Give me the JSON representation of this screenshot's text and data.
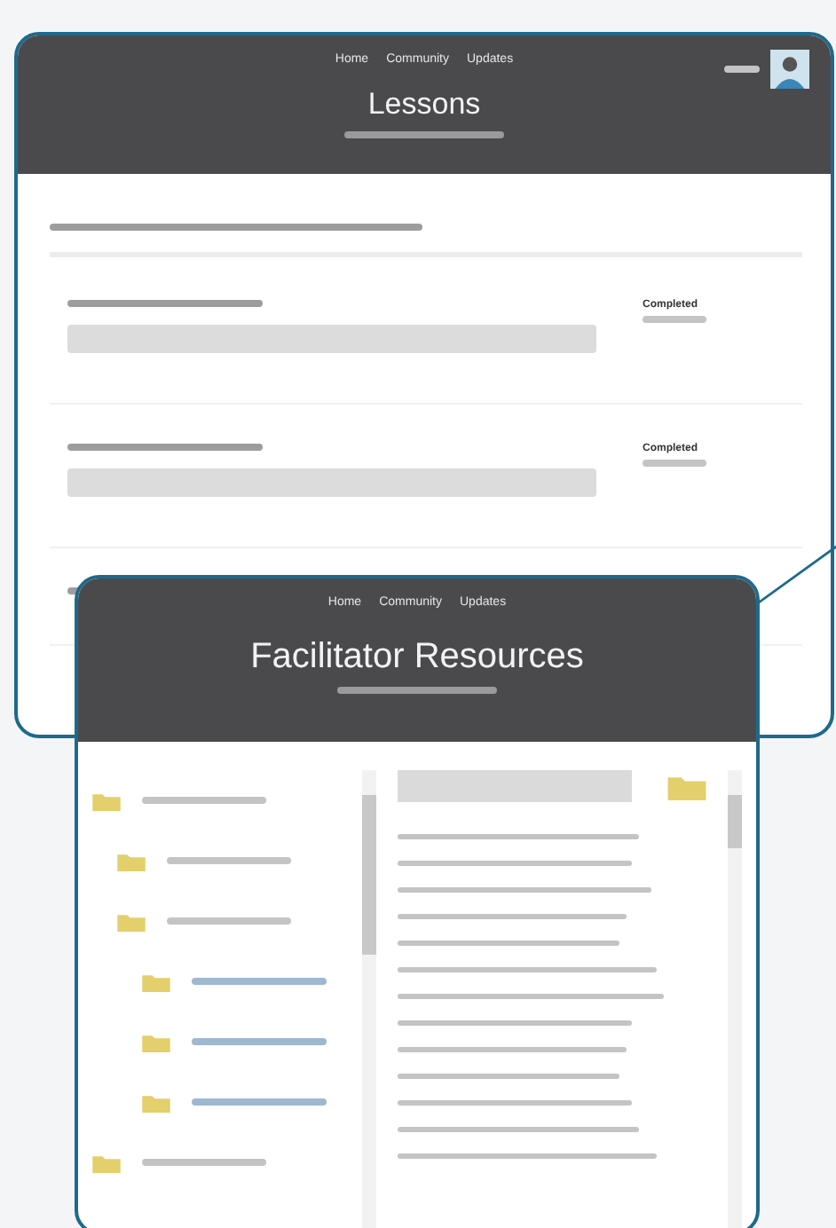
{
  "back_window": {
    "nav": [
      "Home",
      "Community",
      "Updates"
    ],
    "title": "Lessons",
    "lessons": [
      {
        "kind": "full",
        "status": "Completed"
      },
      {
        "kind": "full",
        "status": "Completed"
      },
      {
        "kind": "partial"
      }
    ]
  },
  "front_window": {
    "nav": [
      "Home",
      "Community",
      "Updates"
    ],
    "title": "Facilitator Resources",
    "tree": [
      {
        "kind": "folder",
        "children": [
          {
            "kind": "folder"
          },
          {
            "kind": "folder",
            "children": [
              {
                "kind": "link"
              },
              {
                "kind": "link"
              },
              {
                "kind": "link"
              }
            ]
          }
        ]
      },
      {
        "kind": "folder"
      }
    ],
    "files": [
      {
        "kind": "file"
      },
      {
        "kind": "file"
      },
      {
        "kind": "file"
      },
      {
        "kind": "file"
      },
      {
        "kind": "file"
      },
      {
        "kind": "file"
      },
      {
        "kind": "file"
      },
      {
        "kind": "file"
      },
      {
        "kind": "file"
      },
      {
        "kind": "file"
      },
      {
        "kind": "file"
      },
      {
        "kind": "file"
      },
      {
        "kind": "file"
      }
    ]
  }
}
